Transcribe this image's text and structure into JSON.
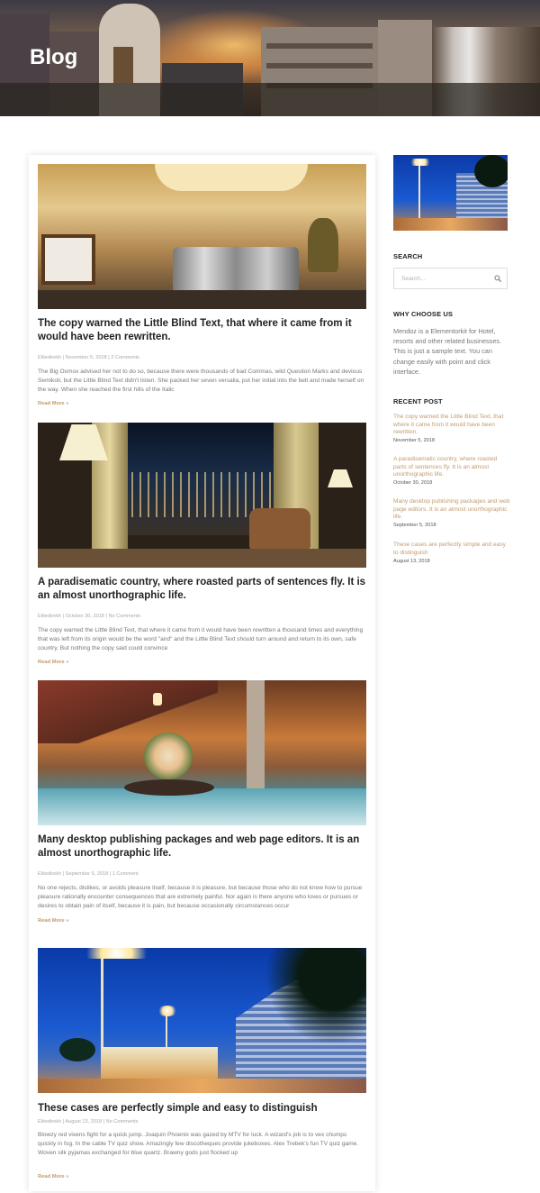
{
  "header": {
    "title": "Blog"
  },
  "posts": [
    {
      "title": "The copy warned the Little Blind Text, that where it came from it would have been rewritten.",
      "meta": "Elitedirekh | November 5, 2018 | 2 Comments",
      "excerpt": "The Big Oxmox advised her not to do so, because there were thousands of bad Commas, wild Question Marks and devious Semikoli, but the Little Blind Text didn't listen. She packed her seven versalia, put her initial into the belt and made herself on the way. When she reached the first hills of the Italic",
      "read_more": "Read More »"
    },
    {
      "title": "A paradisematic country, where roasted parts of sentences fly. It is an almost unorthographic life.",
      "meta": "Elitedirekh | October 30, 2018 | No Comments",
      "excerpt": "The copy warned the Little Blind Text, that where it came from it would have been rewritten a thousand times and everything that was left from its origin would be the word \"and\" and the Little Blind Text should turn around and return to its own, safe country. But nothing the copy said could convince",
      "read_more": "Read More »"
    },
    {
      "title": "Many desktop publishing packages and web page editors. It is an almost unorthographic life.",
      "meta": "Elitedirekh | September 5, 2018 | 1 Comment",
      "excerpt": "No one rejects, dislikes, or avoids pleasure itself, because it is pleasure, but because those who do not know how to pursue pleasure rationally encounter consequences that are extremely painful. Nor again is there anyone who loves or pursues or desires to obtain pain of itself, because it is pain, but because occasionally circumstances occur",
      "read_more": "Read More »"
    },
    {
      "title": "These cases are perfectly simple and easy to distinguish",
      "meta": "Elitedirekh | August 13, 2018 | No Comments",
      "excerpt": "Blowzy red vixens fight for a quick jump. Joaquin Phoenix was gazed by MTV for luck. A wizard's job is to vex chumps quickly in fog. In the cable TV quiz show. Amazingly few discotheques provide jukeboxes. Alex Trebek's fun TV quiz game. Woven silk pyjamas exchanged for blue quartz. Brawny gods just flocked up",
      "read_more": "Read More »"
    }
  ],
  "sidebar": {
    "search": {
      "heading": "SEARCH",
      "placeholder": "Search...",
      "icon": "search-icon"
    },
    "why": {
      "heading": "WHY CHOOSE US",
      "text": "Mendoz is a Elementorkit for Hotel, resorts and other related businesses. This is just a sample text. You can change easily with point and click interface."
    },
    "recent": {
      "heading": "RECENT POST",
      "items": [
        {
          "title": "The copy warned the Little Blind Text, that where it came from it would have been rewritten.",
          "date": "November 5, 2018"
        },
        {
          "title": "A paradisematic country, where roasted parts of sentences fly. It is an almost unorthographic life.",
          "date": "October 30, 2018"
        },
        {
          "title": "Many desktop publishing packages and web page editors. It is an almost unorthographic life.",
          "date": "September 5, 2018"
        },
        {
          "title": "These cases are perfectly simple and easy to distinguish",
          "date": "August 13, 2018"
        }
      ]
    }
  },
  "colors": {
    "accent": "#c49a6c",
    "heading": "#222222",
    "text": "#777777"
  }
}
